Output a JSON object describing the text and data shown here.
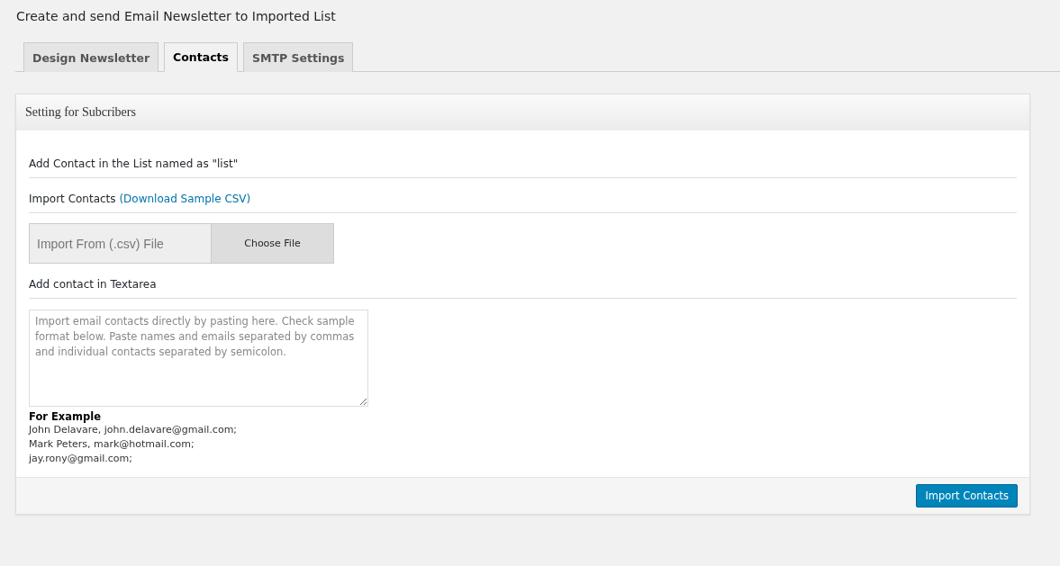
{
  "page_title": "Create and send Email Newsletter to Imported List",
  "tabs": [
    {
      "label": "Design Newsletter",
      "selected": false
    },
    {
      "label": "Contacts",
      "selected": true
    },
    {
      "label": "SMTP Settings",
      "selected": false
    }
  ],
  "panel": {
    "title": "Setting for Subcribers",
    "list_heading": "Add Contact in the List named as \"list\"",
    "import_heading": "Import Contacts",
    "sample_link": "(Download Sample CSV)",
    "file_field": {
      "placeholder": "Import From (.csv) File",
      "button": "Choose File"
    },
    "textarea_heading": "Add contact in Textarea",
    "textarea": {
      "placeholder": "Import email contacts directly by pasting here. Check sample format below. Paste names and emails separated by commas and individual contacts separated by semicolon."
    },
    "example_heading": "For Example",
    "example_lines": [
      "John Delavare, john.delavare@gmail.com;",
      "Mark Peters, mark@hotmail.com;",
      "jay.rony@gmail.com;"
    ],
    "submit_button": "Import Contacts"
  }
}
